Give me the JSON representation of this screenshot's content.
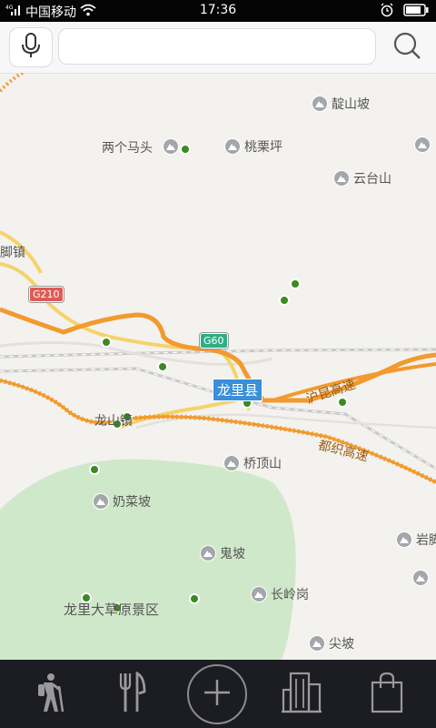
{
  "status_bar": {
    "signal_icon": "signal-icon",
    "carrier": "中国移动",
    "wifi_icon": "wifi-icon",
    "time": "17:36",
    "alarm_icon": "alarm-icon",
    "battery_icon": "battery-icon"
  },
  "search": {
    "mic_icon": "microphone-icon",
    "placeholder": "",
    "search_icon": "search-icon"
  },
  "map": {
    "pois": [
      {
        "label": "靛山坡"
      },
      {
        "label": "桃栗坪"
      },
      {
        "label": "云台山"
      },
      {
        "label": "桥顶山"
      },
      {
        "label": "奶菜坡"
      },
      {
        "label": "鬼坡"
      },
      {
        "label": "长岭岗"
      },
      {
        "label": "尖坡"
      },
      {
        "label": "岩脚"
      }
    ],
    "labels": {
      "liang_ge_ma_tou": "两个马头",
      "jiao_zhen": "谷脚镇",
      "long_shan": "龙山镇",
      "grassland": "龙里大草原景区"
    },
    "roads": {
      "g210": "G210",
      "g60": "G60",
      "hukun": "沪昆高速",
      "duzhi": "都织高速"
    },
    "county": "龙里县",
    "colors": {
      "background": "#f3f2ee",
      "highway": "#f29a2e",
      "national_road": "#f5d36a",
      "green_area": "#cfe8c9",
      "county_label": "#3a8fd8",
      "g210_shield": "#e05a55",
      "g60_shield": "#2fae86"
    }
  },
  "bottom_nav": {
    "items": [
      {
        "icon": "hiker-icon"
      },
      {
        "icon": "fork-knife-icon"
      },
      {
        "icon": "plus-icon"
      },
      {
        "icon": "buildings-icon"
      },
      {
        "icon": "shopping-bag-icon"
      }
    ]
  }
}
